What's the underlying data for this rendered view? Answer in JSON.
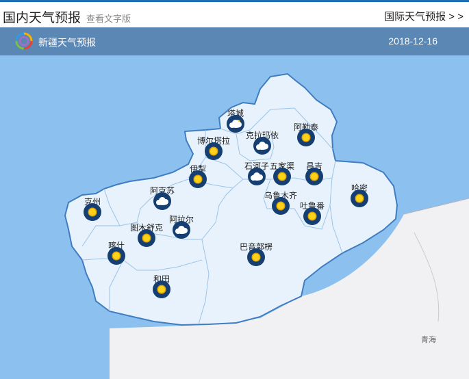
{
  "header": {
    "title": "国内天气预报",
    "subtitle": "查看文字版",
    "intl_link": "国际天气预报 > >"
  },
  "bar": {
    "region_title": "新疆天气预报",
    "date": "2018-12-16"
  },
  "colors": {
    "sea": "#8cc0ee",
    "region_fill": "#e8f2fc",
    "region_border": "#3f7cc0",
    "neighbor": "#f1f1f3",
    "icon_bg": "#153e72",
    "sun": "#ffd21a"
  },
  "map": {
    "neighbor_label": "青海",
    "cities": [
      {
        "name": "塔城",
        "weather": "sun-cloud-icon"
      },
      {
        "name": "阿勒泰",
        "weather": "sun-icon"
      },
      {
        "name": "克拉玛依",
        "weather": "cloud-icon"
      },
      {
        "name": "博尔塔拉",
        "weather": "sun-icon"
      },
      {
        "name": "伊犁",
        "weather": "sun-icon"
      },
      {
        "name": "石河子",
        "weather": "cloud-icon"
      },
      {
        "name": "五家渠",
        "weather": "sun-icon"
      },
      {
        "name": "昌吉",
        "weather": "sun-icon"
      },
      {
        "name": "哈密",
        "weather": "sun-icon"
      },
      {
        "name": "阿克苏",
        "weather": "cloud-icon"
      },
      {
        "name": "乌鲁木齐",
        "weather": "sun-icon"
      },
      {
        "name": "吐鲁番",
        "weather": "sun-icon"
      },
      {
        "name": "克州",
        "weather": "sun-icon"
      },
      {
        "name": "阿拉尔",
        "weather": "cloud-icon"
      },
      {
        "name": "图木舒克",
        "weather": "sun-icon"
      },
      {
        "name": "喀什",
        "weather": "sun-icon"
      },
      {
        "name": "巴音郭楞",
        "weather": "sun-icon"
      },
      {
        "name": "和田",
        "weather": "sun-icon"
      }
    ]
  }
}
